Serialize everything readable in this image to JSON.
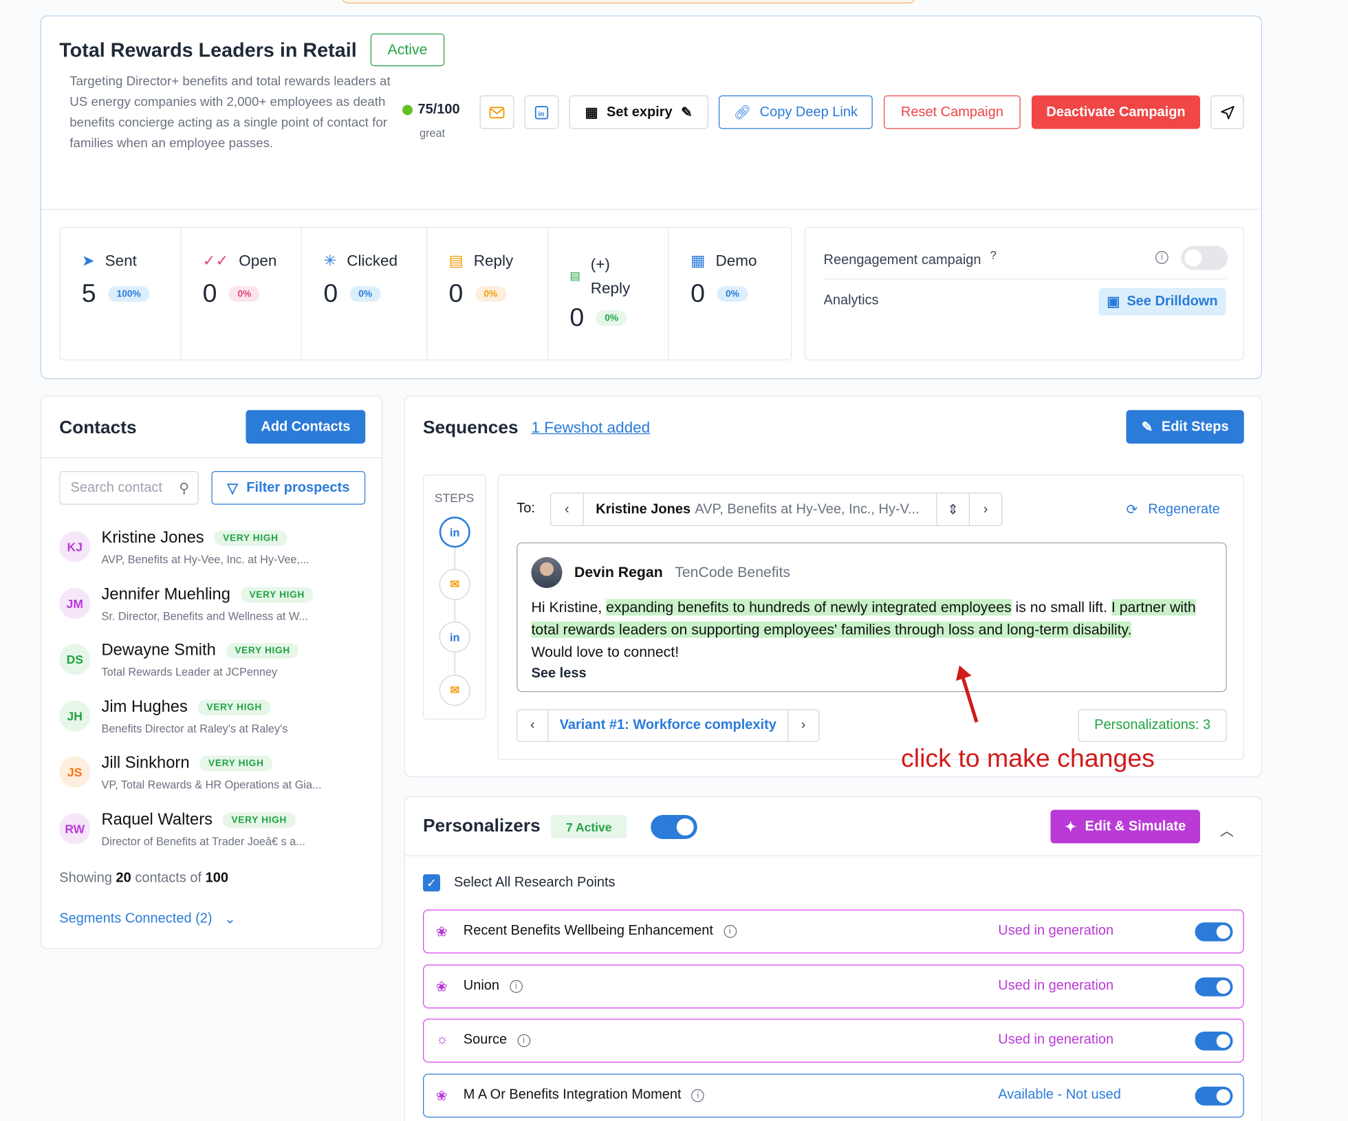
{
  "campaign": {
    "title": "Total Rewards Leaders in Retail",
    "status": "Active",
    "description": "Targeting Director+ benefits and total rewards leaders at US energy companies with 2,000+ employees as death benefits concierge acting as a single point of contact for families when an employee passes.",
    "score": "75/100",
    "score_label": "great",
    "set_expiry": "Set expiry",
    "copy_link": "Copy Deep Link",
    "reset": "Reset Campaign",
    "deactivate": "Deactivate Campaign"
  },
  "stats": [
    {
      "label": "Sent",
      "value": "5",
      "pct": "100%",
      "icon": "send-icon",
      "color": "#2b7bd9",
      "bg": "#dbeefc"
    },
    {
      "label": "Open",
      "value": "0",
      "pct": "0%",
      "icon": "double-check-icon",
      "color": "#e0457b",
      "bg": "#fde4ec"
    },
    {
      "label": "Clicked",
      "value": "0",
      "pct": "0%",
      "icon": "click-icon",
      "color": "#2b7bd9",
      "bg": "#dbeefc"
    },
    {
      "label": "Reply",
      "value": "0",
      "pct": "0%",
      "icon": "reply-icon",
      "color": "#f59e0b",
      "bg": "#fdeedd"
    },
    {
      "label": "(+) Reply",
      "value": "0",
      "pct": "0%",
      "icon": "positive-reply-icon",
      "color": "#22a344",
      "bg": "#e6f6e9"
    },
    {
      "label": "Demo",
      "value": "0",
      "pct": "0%",
      "icon": "calendar-icon",
      "color": "#2b7bd9",
      "bg": "#dbeefc"
    }
  ],
  "reengagement": {
    "label": "Reengagement campaign",
    "help": "?",
    "analytics": "Analytics",
    "drilldown": "See Drilldown"
  },
  "contacts": {
    "title": "Contacts",
    "add": "Add Contacts",
    "search_placeholder": "Search contact",
    "filter": "Filter prospects",
    "items": [
      {
        "initials": "KJ",
        "name": "Kristine Jones",
        "tag": "VERY HIGH",
        "role": "AVP, Benefits at Hy-Vee, Inc. at Hy-Vee,...",
        "color": "#b93ad6",
        "bg": "#f5e6fa"
      },
      {
        "initials": "JM",
        "name": "Jennifer Muehling",
        "tag": "VERY HIGH",
        "role": "Sr. Director, Benefits and Wellness at W...",
        "color": "#b93ad6",
        "bg": "#f5e6fa"
      },
      {
        "initials": "DS",
        "name": "Dewayne Smith",
        "tag": "VERY HIGH",
        "role": "Total Rewards Leader at JCPenney",
        "color": "#22a344",
        "bg": "#e6f6e9"
      },
      {
        "initials": "JH",
        "name": "Jim Hughes",
        "tag": "VERY HIGH",
        "role": "Benefits Director at Raley's at Raley's",
        "color": "#22a344",
        "bg": "#e6f6e9"
      },
      {
        "initials": "JS",
        "name": "Jill Sinkhorn",
        "tag": "VERY HIGH",
        "role": "VP, Total Rewards & HR Operations at Gia...",
        "color": "#f97316",
        "bg": "#fdeedd"
      },
      {
        "initials": "RW",
        "name": "Raquel Walters",
        "tag": "VERY HIGH",
        "role": "Director of Benefits at Trader Joeâ€   s a...",
        "color": "#b93ad6",
        "bg": "#f5e6fa"
      }
    ],
    "showing_prefix": "Showing",
    "showing_count": "20",
    "showing_mid": "contacts of",
    "showing_total": "100",
    "segments": "Segments Connected (2)"
  },
  "sequences": {
    "title": "Sequences",
    "fewshot": "1 Fewshot added",
    "edit": "Edit Steps",
    "steps_label": "STEPS",
    "to_label": "To:",
    "to_name": "Kristine Jones",
    "to_role": "AVP, Benefits at Hy-Vee, Inc., Hy-V...",
    "regenerate": "Regenerate",
    "sender_name": "Devin Regan",
    "sender_company": "TenCode Benefits",
    "body_1": "Hi Kristine, ",
    "body_hl1": "expanding benefits to hundreds of newly integrated employees",
    "body_2": " is no small lift. ",
    "body_hl2": "I partner with total rewards leaders on supporting employees' families through loss and long-term disability.",
    "body_3": "Would love to connect!",
    "see_less": "See less",
    "variant": "Variant #1: Workforce complexity",
    "personalizations": "Personalizations: 3",
    "annotation": "click to make changes"
  },
  "personalizers": {
    "title": "Personalizers",
    "active": "7 Active",
    "edit": "Edit & Simulate",
    "select_all": "Select All Research Points",
    "items": [
      {
        "name": "Recent Benefits Wellbeing Enhancement",
        "status": "Used in generation",
        "icon": "brain-icon"
      },
      {
        "name": "Union",
        "status": "Used in generation",
        "icon": "brain-icon"
      },
      {
        "name": "Source",
        "status": "Used in generation",
        "icon": "lightbulb-icon"
      },
      {
        "name": "M A Or Benefits Integration Moment",
        "status": "Available - Not used",
        "icon": "brain-icon"
      }
    ]
  }
}
